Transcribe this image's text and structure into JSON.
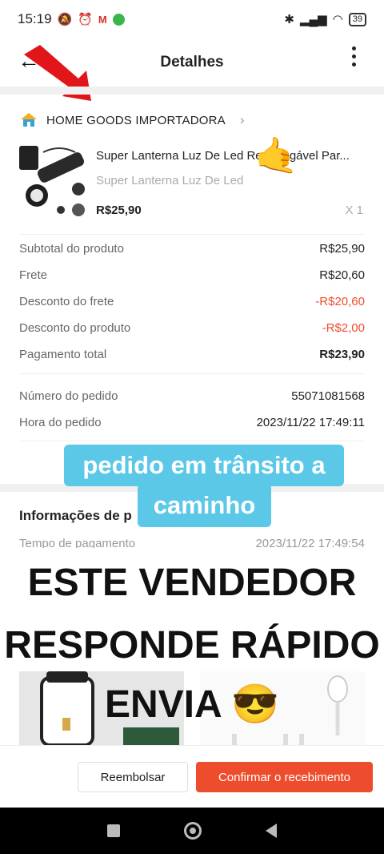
{
  "status_bar": {
    "time": "15:19",
    "battery": "39",
    "network": "4G"
  },
  "header": {
    "title": "Detalhes"
  },
  "shop": {
    "name": "HOME GOODS IMPORTADORA"
  },
  "product": {
    "title": "Super Lanterna Luz De Led Recarregável Par...",
    "variant": "Super Lanterna Luz De Led",
    "price": "R$25,90",
    "quantity": "X 1"
  },
  "summary": [
    {
      "label": "Subtotal do produto",
      "value": "R$25,90"
    },
    {
      "label": "Frete",
      "value": "R$20,60"
    },
    {
      "label": "Desconto do frete",
      "value": "-R$20,60"
    },
    {
      "label": "Desconto do produto",
      "value": "-R$2,00"
    },
    {
      "label": "Pagamento total",
      "value": "R$23,90"
    }
  ],
  "order": [
    {
      "label": "Número do pedido",
      "value": "55071081568"
    },
    {
      "label": "Hora do pedido",
      "value": "2023/11/22 17:49:11"
    }
  ],
  "captions": {
    "line1": "pedido em trânsito a",
    "line2": "caminho"
  },
  "info": {
    "title": "Informações de p",
    "partial_label": "Tempo de pagamento",
    "partial_value": "2023/11/22 17:49:54"
  },
  "overlay": {
    "line1": "ESTE VENDEDOR",
    "line2": "RESPONDE RÁPIDO",
    "line3": "ENVIA 😎"
  },
  "actions": {
    "refund": "Reembolsar",
    "confirm": "Confirmar o recebimento"
  },
  "colors": {
    "accent": "#ee4d2d",
    "caption_bg": "#5bc8e8"
  }
}
